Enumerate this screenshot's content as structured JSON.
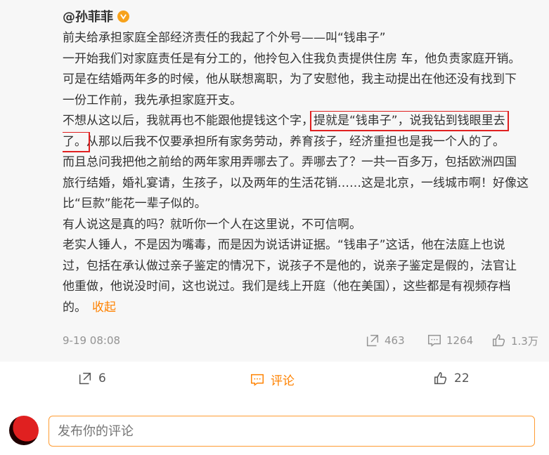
{
  "comment": {
    "author": "@孙菲菲",
    "lines": [
      "前夫给承担家庭全部经济责任的我起了个外号——叫“钱串子”",
      "一开始我们对家庭责任是有分工的，他拎包入住我负责提供住房 车，他负责家庭开销。",
      "可是在结婚两年多的时候，他从联想离职，为了安慰他，我主动提出在他还没有找到下",
      "一份工作前，我先承担家庭开支。"
    ],
    "line5_pre": "不想从这以后，我就再也不能跟他提钱这个字，",
    "line5_highlight": "提就是“钱串子”，说我钻到钱眼里去",
    "line6_highlight": "了。",
    "line6_post": "从那以后我不仅要承担所有家务劳动，养育孩子，经济重担也是我一个人的了。",
    "lines_after": [
      "而且总问我把他之前给的两年家用弄哪去了。弄哪去了？一共一百多万，包括欧洲四国",
      "旅行结婚，婚礼宴请，生孩子，以及两年的生活花销……这是北京，一线城市啊！好像这",
      "比“巨款”能花一辈子似的。",
      "有人说这是真的吗？就听你一个人在这里说，不可信啊。",
      "老实人锤人，不是因为嘴毒，而是因为说话讲证据。“钱串子”这话，他在法庭上也说",
      "过，包括在承认做过亲子鉴定的情况下，说孩子不是他的，说亲子鉴定是假的，法官让",
      "他重做，他说没时间，这也说过。我们是线上开庭（他在美国），这些都是有视频存档"
    ],
    "last_line": "的。",
    "collapse_label": "收起",
    "time": "9-19 08:08",
    "reposts": "463",
    "comments": "1264",
    "likes": "1.3万"
  },
  "action_bar": {
    "reposts": "6",
    "comment_label": "评论",
    "likes": "22"
  },
  "input": {
    "placeholder": "发布你的评论"
  },
  "colors": {
    "accent": "#ff8200",
    "highlight_box": "#e02020",
    "card_bg": "#f7f7f7"
  }
}
